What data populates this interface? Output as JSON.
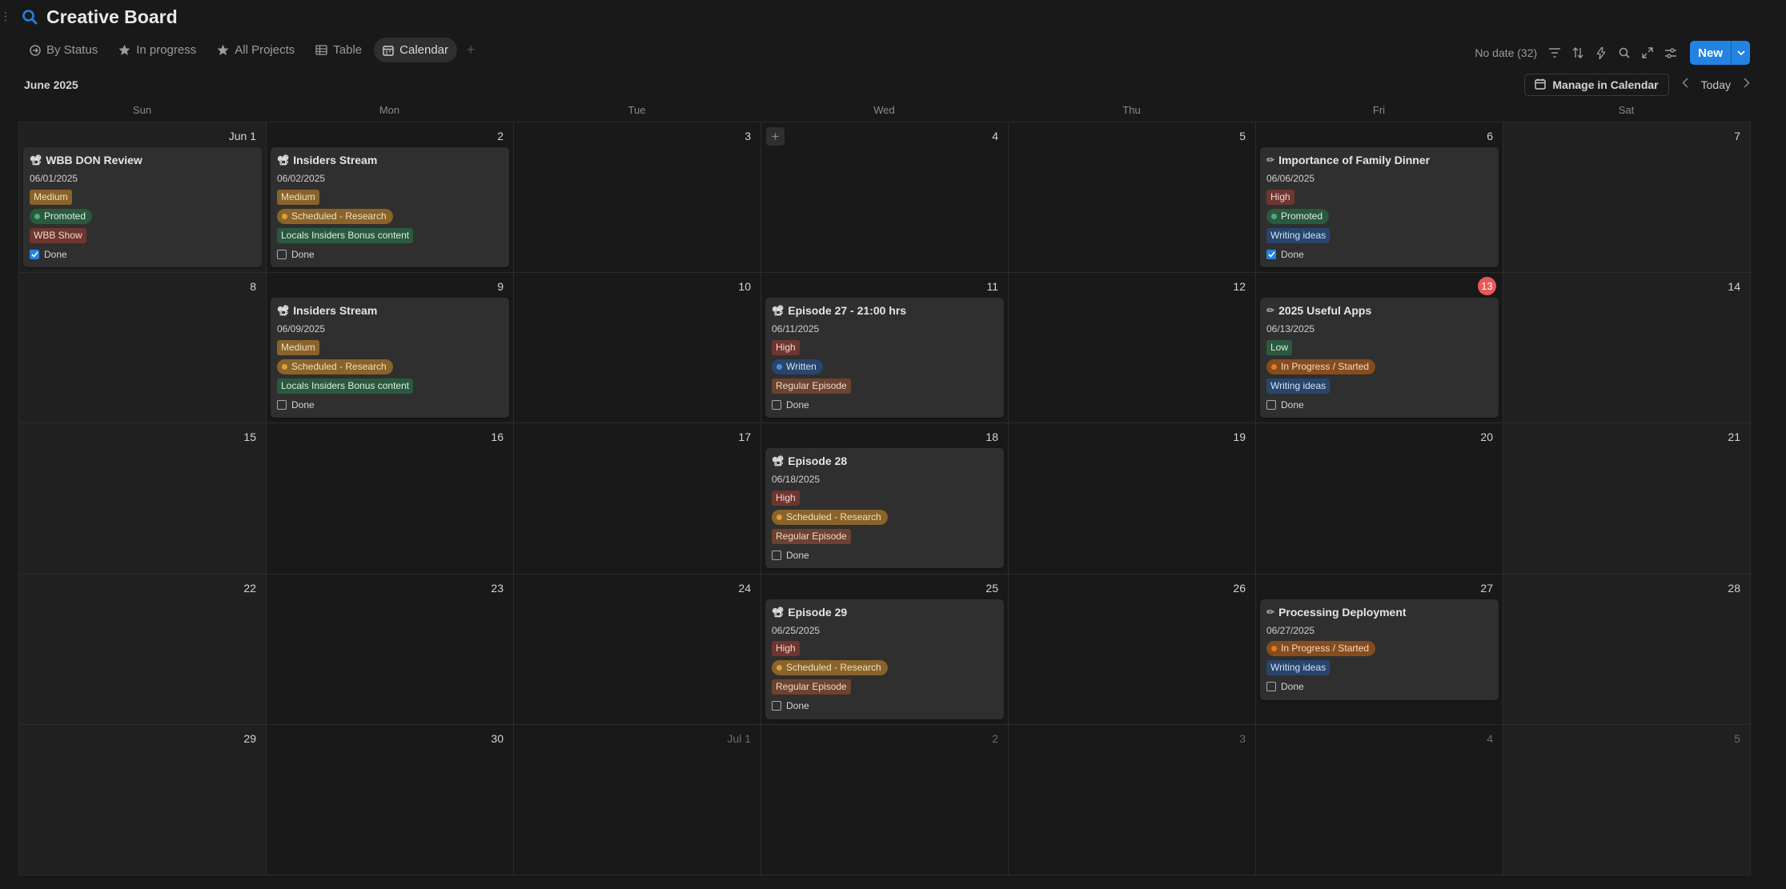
{
  "header": {
    "title": "Creative Board",
    "left_dots": "⋮"
  },
  "tabs": [
    {
      "label": "By Status",
      "icon": "arrow-circle-icon",
      "active": false
    },
    {
      "label": "In progress",
      "icon": "star-icon",
      "active": false
    },
    {
      "label": "All Projects",
      "icon": "star-icon",
      "active": false
    },
    {
      "label": "Table",
      "icon": "table-icon",
      "active": false
    },
    {
      "label": "Calendar",
      "icon": "calendar-icon",
      "active": true
    }
  ],
  "tab_add": "+",
  "toolbar": {
    "no_date": "No date (32)",
    "new_label": "New",
    "icons": [
      "filter-icon",
      "sort-icon",
      "lightning-icon",
      "search-icon",
      "expand-icon",
      "settings-sliders-icon"
    ]
  },
  "calendar": {
    "month_label": "June 2025",
    "manage_label": "Manage in Calendar",
    "today_label": "Today",
    "days_of_week": [
      "Sun",
      "Mon",
      "Tue",
      "Wed",
      "Thu",
      "Fri",
      "Sat"
    ],
    "cells": [
      {
        "label": "Jun 1",
        "muted": false,
        "weekend": true,
        "event": {
          "icon": "📽",
          "title": "WBB DON Review",
          "date": "06/01/2025",
          "tags": [
            {
              "kind": "tag",
              "text": "Medium",
              "bg": "#89632a",
              "fg": "#f0e0c0"
            },
            {
              "kind": "pill",
              "text": "Promoted",
              "bg": "#2b593f",
              "fg": "#d8f0e0",
              "dot": "#4dab7a"
            },
            {
              "kind": "tag",
              "text": "WBB Show",
              "bg": "#6e3630",
              "fg": "#f5d5d0"
            }
          ],
          "done_label": "Done",
          "done": true
        }
      },
      {
        "label": "2",
        "muted": false,
        "weekend": false,
        "event": {
          "icon": "📽",
          "title": "Insiders Stream",
          "date": "06/02/2025",
          "tags": [
            {
              "kind": "tag",
              "text": "Medium",
              "bg": "#89632a",
              "fg": "#f0e0c0"
            },
            {
              "kind": "pill",
              "text": "Scheduled - Research",
              "bg": "#89632a",
              "fg": "#f0e0c0",
              "dot": "#d9a03a"
            },
            {
              "kind": "tag",
              "text": "Locals Insiders Bonus content",
              "bg": "#2b593f",
              "fg": "#d8f0e0"
            }
          ],
          "done_label": "Done",
          "done": false
        }
      },
      {
        "label": "3",
        "muted": false,
        "weekend": false,
        "event": null
      },
      {
        "label": "4",
        "muted": false,
        "weekend": false,
        "event": null,
        "plus": true
      },
      {
        "label": "5",
        "muted": false,
        "weekend": false,
        "event": null
      },
      {
        "label": "6",
        "muted": false,
        "weekend": false,
        "event": {
          "icon": "✏",
          "title": "Importance of Family Dinner",
          "date": "06/06/2025",
          "tags": [
            {
              "kind": "tag",
              "text": "High",
              "bg": "#6e3630",
              "fg": "#f5d5d0"
            },
            {
              "kind": "pill",
              "text": "Promoted",
              "bg": "#2b593f",
              "fg": "#d8f0e0",
              "dot": "#4dab7a"
            },
            {
              "kind": "tag",
              "text": "Writing ideas",
              "bg": "#28456c",
              "fg": "#d0e2f5"
            }
          ],
          "done_label": "Done",
          "done": true
        }
      },
      {
        "label": "7",
        "muted": false,
        "weekend": true,
        "event": null
      },
      {
        "label": "8",
        "muted": false,
        "weekend": true,
        "event": null
      },
      {
        "label": "9",
        "muted": false,
        "weekend": false,
        "event": {
          "icon": "📽",
          "title": "Insiders Stream",
          "date": "06/09/2025",
          "tags": [
            {
              "kind": "tag",
              "text": "Medium",
              "bg": "#89632a",
              "fg": "#f0e0c0"
            },
            {
              "kind": "pill",
              "text": "Scheduled - Research",
              "bg": "#89632a",
              "fg": "#f0e0c0",
              "dot": "#d9a03a"
            },
            {
              "kind": "tag",
              "text": "Locals Insiders Bonus content",
              "bg": "#2b593f",
              "fg": "#d8f0e0"
            }
          ],
          "done_label": "Done",
          "done": false
        }
      },
      {
        "label": "10",
        "muted": false,
        "weekend": false,
        "event": null
      },
      {
        "label": "11",
        "muted": false,
        "weekend": false,
        "event": {
          "icon": "📽",
          "title": "Episode 27 - 21:00 hrs",
          "date": "06/11/2025",
          "tags": [
            {
              "kind": "tag",
              "text": "High",
              "bg": "#6e3630",
              "fg": "#f5d5d0"
            },
            {
              "kind": "pill",
              "text": "Written",
              "bg": "#28456c",
              "fg": "#d0e2f5",
              "dot": "#4a8fd9"
            },
            {
              "kind": "tag",
              "text": "Regular Episode",
              "bg": "#6b4330",
              "fg": "#f0d8c8"
            }
          ],
          "done_label": "Done",
          "done": false
        }
      },
      {
        "label": "12",
        "muted": false,
        "weekend": false,
        "event": null
      },
      {
        "label": "13",
        "muted": false,
        "weekend": false,
        "today": true,
        "event": {
          "icon": "✏",
          "title": "2025 Useful Apps",
          "date": "06/13/2025",
          "tags": [
            {
              "kind": "tag",
              "text": "Low",
              "bg": "#2b593f",
              "fg": "#d8f0e0"
            },
            {
              "kind": "pill",
              "text": "In Progress / Started",
              "bg": "#854c1d",
              "fg": "#f5dcc5",
              "dot": "#e07b2a"
            },
            {
              "kind": "tag",
              "text": "Writing ideas",
              "bg": "#28456c",
              "fg": "#d0e2f5"
            }
          ],
          "done_label": "Done",
          "done": false
        }
      },
      {
        "label": "14",
        "muted": false,
        "weekend": true,
        "event": null
      },
      {
        "label": "15",
        "muted": false,
        "weekend": true,
        "event": null
      },
      {
        "label": "16",
        "muted": false,
        "weekend": false,
        "event": null
      },
      {
        "label": "17",
        "muted": false,
        "weekend": false,
        "event": null
      },
      {
        "label": "18",
        "muted": false,
        "weekend": false,
        "event": {
          "icon": "📽",
          "title": "Episode 28",
          "date": "06/18/2025",
          "tags": [
            {
              "kind": "tag",
              "text": "High",
              "bg": "#6e3630",
              "fg": "#f5d5d0"
            },
            {
              "kind": "pill",
              "text": "Scheduled - Research",
              "bg": "#89632a",
              "fg": "#f0e0c0",
              "dot": "#d9a03a"
            },
            {
              "kind": "tag",
              "text": "Regular Episode",
              "bg": "#6b4330",
              "fg": "#f0d8c8"
            }
          ],
          "done_label": "Done",
          "done": false
        }
      },
      {
        "label": "19",
        "muted": false,
        "weekend": false,
        "event": null
      },
      {
        "label": "20",
        "muted": false,
        "weekend": false,
        "event": null
      },
      {
        "label": "21",
        "muted": false,
        "weekend": true,
        "event": null
      },
      {
        "label": "22",
        "muted": false,
        "weekend": true,
        "event": null
      },
      {
        "label": "23",
        "muted": false,
        "weekend": false,
        "event": null
      },
      {
        "label": "24",
        "muted": false,
        "weekend": false,
        "event": null
      },
      {
        "label": "25",
        "muted": false,
        "weekend": false,
        "event": {
          "icon": "📽",
          "title": "Episode 29",
          "date": "06/25/2025",
          "tags": [
            {
              "kind": "tag",
              "text": "High",
              "bg": "#6e3630",
              "fg": "#f5d5d0"
            },
            {
              "kind": "pill",
              "text": "Scheduled - Research",
              "bg": "#89632a",
              "fg": "#f0e0c0",
              "dot": "#d9a03a"
            },
            {
              "kind": "tag",
              "text": "Regular Episode",
              "bg": "#6b4330",
              "fg": "#f0d8c8"
            }
          ],
          "done_label": "Done",
          "done": false
        }
      },
      {
        "label": "26",
        "muted": false,
        "weekend": false,
        "event": null
      },
      {
        "label": "27",
        "muted": false,
        "weekend": false,
        "event": {
          "icon": "✏",
          "title": "Processing Deployment",
          "date": "06/27/2025",
          "tags": [
            {
              "kind": "pill",
              "text": "In Progress / Started",
              "bg": "#854c1d",
              "fg": "#f5dcc5",
              "dot": "#e07b2a"
            },
            {
              "kind": "tag",
              "text": "Writing ideas",
              "bg": "#28456c",
              "fg": "#d0e2f5"
            }
          ],
          "done_label": "Done",
          "done": false
        }
      },
      {
        "label": "28",
        "muted": false,
        "weekend": true,
        "event": null
      },
      {
        "label": "29",
        "muted": false,
        "weekend": true,
        "event": null
      },
      {
        "label": "30",
        "muted": false,
        "weekend": false,
        "event": null
      },
      {
        "label": "Jul 1",
        "muted": true,
        "weekend": false,
        "event": null
      },
      {
        "label": "2",
        "muted": true,
        "weekend": false,
        "event": null
      },
      {
        "label": "3",
        "muted": true,
        "weekend": false,
        "event": null
      },
      {
        "label": "4",
        "muted": true,
        "weekend": false,
        "event": null
      },
      {
        "label": "5",
        "muted": true,
        "weekend": true,
        "event": null
      }
    ]
  },
  "colors": {
    "accent": "#2383e2",
    "today": "#eb5757",
    "background": "#191919",
    "card": "#2f2f2f"
  }
}
